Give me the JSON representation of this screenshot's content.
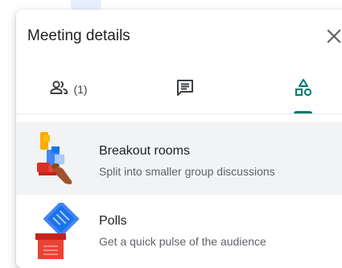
{
  "panel": {
    "title": "Meeting details"
  },
  "tabs": [
    {
      "name": "people",
      "icon": "people-icon",
      "count": "(1)",
      "active": false
    },
    {
      "name": "chat",
      "icon": "chat-icon",
      "active": false
    },
    {
      "name": "activities",
      "icon": "activities-icon",
      "active": true
    }
  ],
  "activities": [
    {
      "title": "Breakout rooms",
      "subtitle": "Split into smaller group discussions",
      "icon": "breakout-rooms-illustration",
      "highlighted": true
    },
    {
      "title": "Polls",
      "subtitle": "Get a quick pulse of the audience",
      "icon": "polls-illustration",
      "highlighted": false
    }
  ],
  "colors": {
    "accent": "#00796b",
    "hover_row": "#f1f3f4",
    "text_primary": "#202124",
    "text_secondary": "#5f6368"
  }
}
